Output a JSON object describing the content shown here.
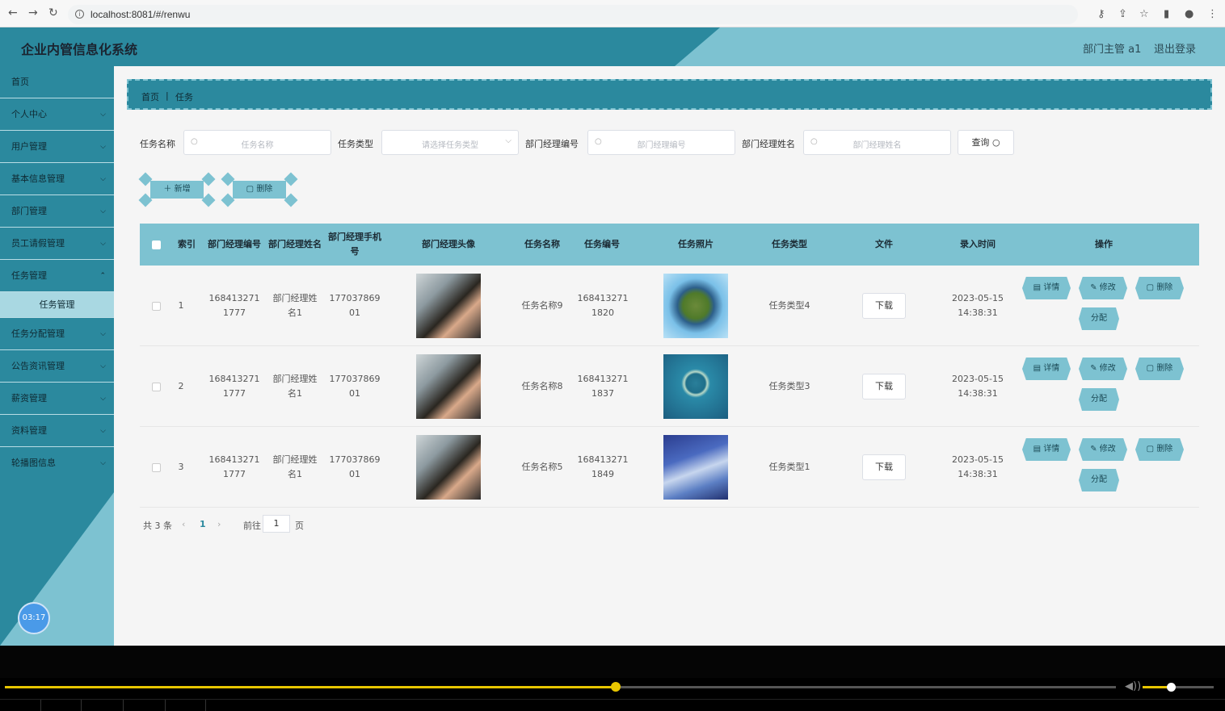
{
  "browser": {
    "url": "localhost:8081/#/renwu"
  },
  "header": {
    "title": "企业内管信息化系统",
    "user": "部门主管 a1",
    "logout": "退出登录"
  },
  "sidebar": {
    "items": [
      {
        "label": "首页"
      },
      {
        "label": "个人中心"
      },
      {
        "label": "用户管理"
      },
      {
        "label": "基本信息管理"
      },
      {
        "label": "部门管理"
      },
      {
        "label": "员工请假管理"
      },
      {
        "label": "任务管理"
      },
      {
        "label": "任务分配管理"
      },
      {
        "label": "公告资讯管理"
      },
      {
        "label": "薪资管理"
      },
      {
        "label": "资料管理"
      },
      {
        "label": "轮播图信息"
      }
    ],
    "submenu": "任务管理",
    "timer": "03:17"
  },
  "breadcrumb": {
    "home": "首页",
    "sep": "|",
    "current": "任务"
  },
  "search": {
    "task_name_label": "任务名称",
    "task_name_placeholder": "任务名称",
    "task_type_label": "任务类型",
    "task_type_placeholder": "请选择任务类型",
    "mgr_no_label": "部门经理编号",
    "mgr_no_placeholder": "部门经理编号",
    "mgr_name_label": "部门经理姓名",
    "mgr_name_placeholder": "部门经理姓名",
    "query": "查询"
  },
  "actions": {
    "add": "＋ 新增",
    "delete": "删除"
  },
  "table": {
    "headers": {
      "index": "索引",
      "mgr_no": "部门经理编号",
      "mgr_name": "部门经理姓名",
      "mgr_phone": "部门经理手机号",
      "avatar": "部门经理头像",
      "task_name": "任务名称",
      "task_no": "任务编号",
      "photo": "任务照片",
      "task_type": "任务类型",
      "file": "文件",
      "time": "录入时间",
      "ops": "操作"
    },
    "rows": [
      {
        "index": "1",
        "mgr_no": "1684132711777",
        "mgr_name": "部门经理姓名1",
        "mgr_phone": "17703786901",
        "task_name": "任务名称9",
        "task_no": "1684132711820",
        "task_type": "任务类型4",
        "file": "下载",
        "time": "2023-05-15 14:38:31"
      },
      {
        "index": "2",
        "mgr_no": "1684132711777",
        "mgr_name": "部门经理姓名1",
        "mgr_phone": "17703786901",
        "task_name": "任务名称8",
        "task_no": "1684132711837",
        "task_type": "任务类型3",
        "file": "下载",
        "time": "2023-05-15 14:38:31"
      },
      {
        "index": "3",
        "mgr_no": "1684132711777",
        "mgr_name": "部门经理姓名1",
        "mgr_phone": "17703786901",
        "task_name": "任务名称5",
        "task_no": "1684132711849",
        "task_type": "任务类型1",
        "file": "下载",
        "time": "2023-05-15 14:38:31"
      }
    ],
    "ops": {
      "detail": "详情",
      "edit": "修改",
      "delete": "删除",
      "assign": "分配"
    }
  },
  "pager": {
    "total": "共 3 条",
    "prev": "‹",
    "page": "1",
    "next": "›",
    "goto_prefix": "前往",
    "goto_value": "1",
    "goto_suffix": "页"
  },
  "player": {
    "progress": 0.55,
    "volume": 0.4
  }
}
